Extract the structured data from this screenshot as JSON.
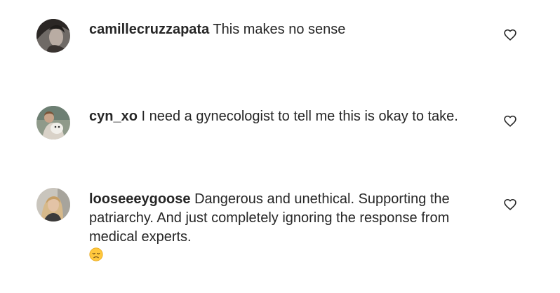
{
  "comments": [
    {
      "username": "camillecruzzapata",
      "text": "This makes no sense",
      "avatar_icon": "avatar-camillecruzzapata",
      "like_icon": "heart-outline-icon"
    },
    {
      "username": "cyn_xo",
      "text": "I need a gynecologist to tell me this is okay to take.",
      "avatar_icon": "avatar-cyn_xo",
      "like_icon": "heart-outline-icon"
    },
    {
      "username": "looseeeygoose",
      "text_lines": [
        "Dangerous and unethical. Supporting the",
        "patriarchy. And just completely ignoring the response from",
        "medical experts."
      ],
      "emoji": "disappointed-face-emoji",
      "avatar_icon": "avatar-looseeeygoose",
      "like_icon": "heart-outline-icon"
    }
  ],
  "colors": {
    "text": "#262626",
    "background": "#ffffff"
  }
}
